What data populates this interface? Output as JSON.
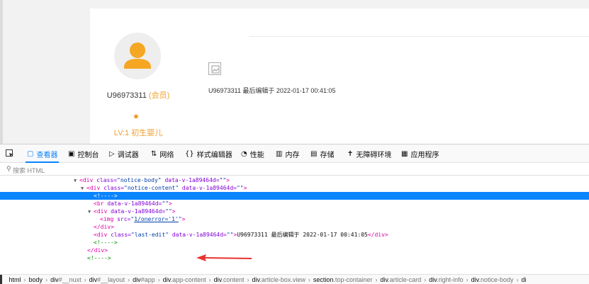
{
  "page": {
    "username": "U96973311",
    "role_label": "(会员)",
    "star": "★",
    "level_label": "LV:1 初生婴儿",
    "last_edit_text": "U96973311 最后编辑于 2022-01-17 00:41:05"
  },
  "devtools": {
    "tabs": [
      {
        "icon": "inspector-icon",
        "label": "查看器"
      },
      {
        "icon": "console-icon",
        "label": "控制台"
      },
      {
        "icon": "debugger-icon",
        "label": "调试器"
      },
      {
        "icon": "network-icon",
        "label": "网络"
      },
      {
        "icon": "style-editor-icon",
        "label": "样式编辑器"
      },
      {
        "icon": "performance-icon",
        "label": "性能"
      },
      {
        "icon": "memory-icon",
        "label": "内存"
      },
      {
        "icon": "storage-icon",
        "label": "存储"
      },
      {
        "icon": "accessibility-icon",
        "label": "无障碍环境"
      },
      {
        "icon": "application-icon",
        "label": "应用程序"
      }
    ],
    "search_placeholder": "搜索 HTML",
    "tree": {
      "l1_tag_open": "<div ",
      "l1_attr1": "class=",
      "l1_val1": "\"notice-body\"",
      "l1_attr2": "data-v-1a89464d=",
      "l1_val2": "\"\"",
      "l1_tag_close": ">",
      "l2_tag_open": "<div ",
      "l2_attr1": "class=",
      "l2_val1": "\"notice-content\"",
      "l2_attr2": "data-v-1a89464d=",
      "l2_val2": "\"\"",
      "l2_tag_close": ">",
      "l3_comment": "<!---->",
      "l4_tag_open": "<br ",
      "l4_attr": "data-v-1a89464d=",
      "l4_val": "\"\"",
      "l4_tag_close": ">",
      "l5_tag_open": "<div ",
      "l5_attr": "data-v-1a89464d=",
      "l5_val": "\"\"",
      "l5_tag_close": ">",
      "l6_tag_open": "<img ",
      "l6_attr": "src=",
      "l6_quote_open": "\"",
      "l6_val": "1/onerror='1'",
      "l6_quote_close": "\"",
      "l6_tag_close": ">",
      "l7_tag": "</div>",
      "l8_tag_open": "<div ",
      "l8_attr1": "class=",
      "l8_val1": "\"last-edit\"",
      "l8_attr2": "data-v-1a89464d=",
      "l8_val2": "\"\"",
      "l8_tag_close": ">",
      "l8_text": "U96973311 最后编辑于 2022-01-17 00:41:05",
      "l8_end": "</div>",
      "l9_comment": "<!---->",
      "l10_tag": "</div>",
      "l11_comment": "<!---->"
    },
    "breadcrumb": [
      {
        "tag": "html",
        "cls": ""
      },
      {
        "tag": "body",
        "cls": ""
      },
      {
        "tag": "div",
        "cls": "#__nuxt"
      },
      {
        "tag": "div",
        "cls": "#__layout"
      },
      {
        "tag": "div",
        "cls": "#app"
      },
      {
        "tag": "div",
        "cls": ".app-content"
      },
      {
        "tag": "div",
        "cls": ".content"
      },
      {
        "tag": "div",
        "cls": ".article-box.view"
      },
      {
        "tag": "section",
        "cls": ".top-container"
      },
      {
        "tag": "div",
        "cls": ".article-card"
      },
      {
        "tag": "div",
        "cls": ".right-info"
      },
      {
        "tag": "div",
        "cls": ".notice-body"
      },
      {
        "tag": "di",
        "cls": ""
      }
    ],
    "accent_color": "#0a84ff",
    "arrow_color": "#e8322f"
  }
}
